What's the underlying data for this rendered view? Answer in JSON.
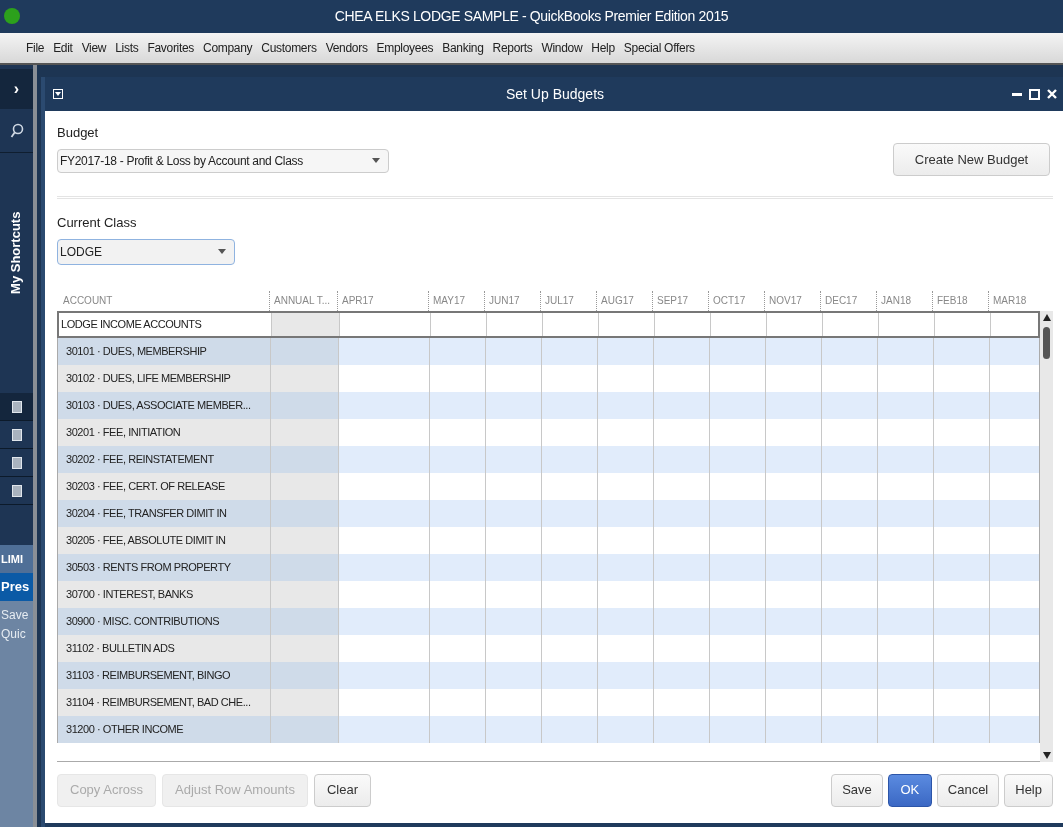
{
  "window": {
    "title": "CHEA ELKS LODGE SAMPLE  - QuickBooks Premier Edition 2015"
  },
  "menu": [
    "File",
    "Edit",
    "View",
    "Lists",
    "Favorites",
    "Company",
    "Customers",
    "Vendors",
    "Employees",
    "Banking",
    "Reports",
    "Window",
    "Help",
    "Special Offers"
  ],
  "sidebar": {
    "expand_button": "›",
    "title": "My Shortcuts",
    "texts": [
      "LIMI",
      "Pres",
      "Save",
      "Quic"
    ]
  },
  "dialog": {
    "title": "Set Up Budgets",
    "budget": {
      "label": "Budget",
      "value": "FY2017-18 - Profit & Loss by Account and Class"
    },
    "create_button": "Create New Budget",
    "current_class": {
      "label": "Current Class",
      "value": "LODGE"
    },
    "table": {
      "columns": [
        "ACCOUNT",
        "ANNUAL T...",
        "APR17",
        "MAY17",
        "JUN17",
        "JUL17",
        "AUG17",
        "SEP17",
        "OCT17",
        "NOV17",
        "DEC17",
        "JAN18",
        "FEB18",
        "MAR18"
      ],
      "rows": [
        {
          "account": "LODGE INCOME ACCOUNTS",
          "kind": "header",
          "selected": true
        },
        {
          "account": "30101 · DUES, MEMBERSHIP",
          "kind": "account",
          "selected": false
        },
        {
          "account": "30102 · DUES, LIFE MEMBERSHIP",
          "kind": "account",
          "selected": false
        },
        {
          "account": "30103 · DUES, ASSOCIATE MEMBER...",
          "kind": "account",
          "selected": false
        },
        {
          "account": "30201 · FEE, INITIATION",
          "kind": "account",
          "selected": false
        },
        {
          "account": "30202 · FEE, REINSTATEMENT",
          "kind": "account",
          "selected": false
        },
        {
          "account": "30203 · FEE, CERT. OF RELEASE",
          "kind": "account",
          "selected": false
        },
        {
          "account": "30204 · FEE, TRANSFER DIMIT IN",
          "kind": "account",
          "selected": false
        },
        {
          "account": "30205 · FEE, ABSOLUTE DIMIT IN",
          "kind": "account",
          "selected": false
        },
        {
          "account": "30503 · RENTS FROM PROPERTY",
          "kind": "account",
          "selected": false
        },
        {
          "account": "30700 · INTEREST, BANKS",
          "kind": "account",
          "selected": false
        },
        {
          "account": "30900 · MISC. CONTRIBUTIONS",
          "kind": "account",
          "selected": false
        },
        {
          "account": "31102 · BULLETIN ADS",
          "kind": "account",
          "selected": false
        },
        {
          "account": "31103 · REIMBURSEMENT, BINGO",
          "kind": "account",
          "selected": false
        },
        {
          "account": "31104 · REIMBURSEMENT, BAD CHE...",
          "kind": "account",
          "selected": false
        },
        {
          "account": "31200 · OTHER INCOME",
          "kind": "account",
          "selected": false
        }
      ]
    },
    "left_buttons": [
      {
        "label": "Copy Across",
        "disabled": true
      },
      {
        "label": "Adjust Row Amounts",
        "disabled": true
      },
      {
        "label": "Clear",
        "disabled": false
      }
    ],
    "right_buttons": [
      {
        "label": "Save",
        "kind": "normal"
      },
      {
        "label": "OK",
        "kind": "default"
      },
      {
        "label": "Cancel",
        "kind": "normal"
      },
      {
        "label": "Help",
        "kind": "normal"
      }
    ]
  }
}
